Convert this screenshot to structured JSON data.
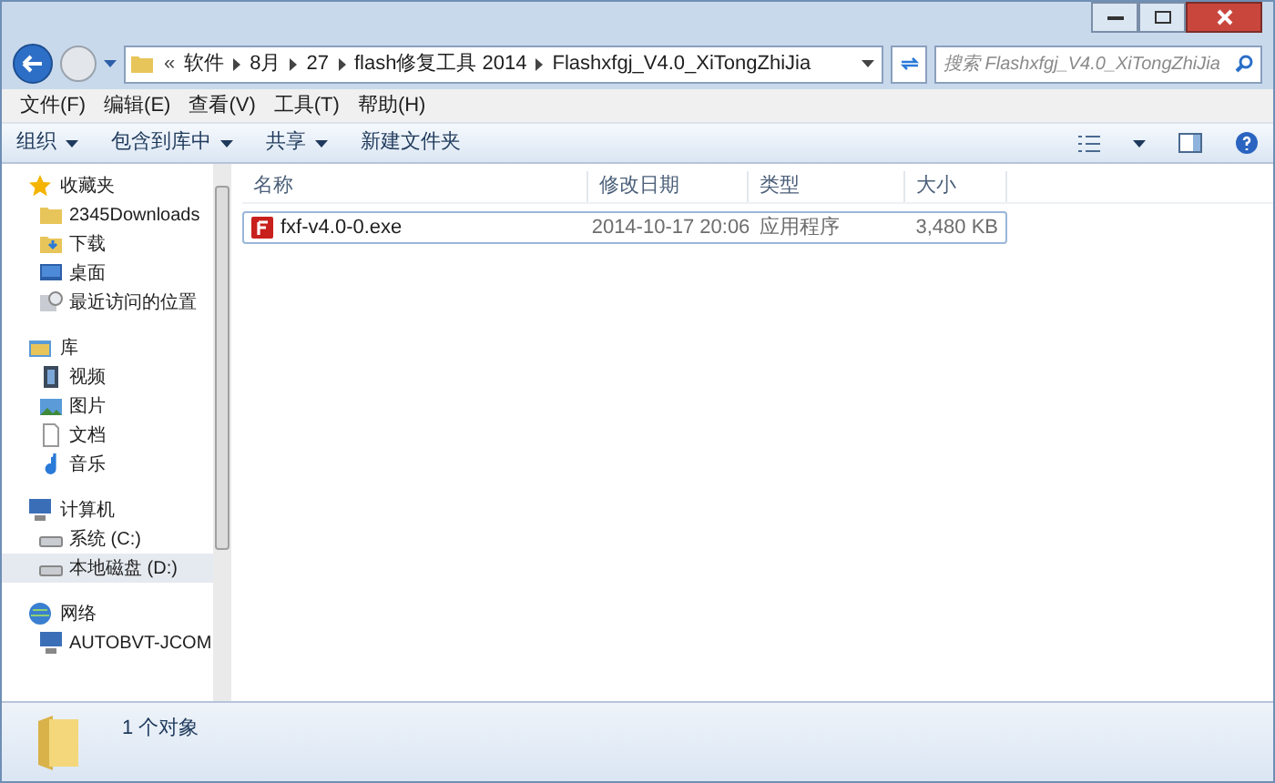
{
  "address": {
    "overflow": "«",
    "crumbs": [
      "软件",
      "8月",
      "27",
      "flash修复工具 2014",
      "Flashxfgj_V4.0_XiTongZhiJia"
    ]
  },
  "search": {
    "placeholder": "搜索 Flashxfgj_V4.0_XiTongZhiJia"
  },
  "menu": [
    "文件(F)",
    "编辑(E)",
    "查看(V)",
    "工具(T)",
    "帮助(H)"
  ],
  "toolbar": [
    {
      "label": "组织",
      "dropdown": true
    },
    {
      "label": "包含到库中",
      "dropdown": true
    },
    {
      "label": "共享",
      "dropdown": true
    },
    {
      "label": "新建文件夹",
      "dropdown": false
    }
  ],
  "sidebar": [
    {
      "label": "收藏夹",
      "kind": "favorites",
      "children": [
        {
          "label": "2345Downloads",
          "kind": "folder",
          "selected": false
        },
        {
          "label": "下载",
          "kind": "downloads",
          "selected": false
        },
        {
          "label": "桌面",
          "kind": "desktop",
          "selected": false
        },
        {
          "label": "最近访问的位置",
          "kind": "recent",
          "selected": false
        }
      ]
    },
    {
      "label": "库",
      "kind": "library",
      "children": [
        {
          "label": "视频",
          "kind": "video",
          "selected": false
        },
        {
          "label": "图片",
          "kind": "picture",
          "selected": false
        },
        {
          "label": "文档",
          "kind": "document",
          "selected": false
        },
        {
          "label": "音乐",
          "kind": "music",
          "selected": false
        }
      ]
    },
    {
      "label": "计算机",
      "kind": "computer",
      "children": [
        {
          "label": "系统 (C:)",
          "kind": "drive",
          "selected": false
        },
        {
          "label": "本地磁盘 (D:)",
          "kind": "drive",
          "selected": true
        }
      ]
    },
    {
      "label": "网络",
      "kind": "network",
      "children": [
        {
          "label": "AUTOBVT-JCOM",
          "kind": "computer",
          "selected": false
        }
      ]
    }
  ],
  "columns": [
    "名称",
    "修改日期",
    "类型",
    "大小"
  ],
  "rows": [
    {
      "name": "fxf-v4.0-0.exe",
      "date": "2014-10-17 20:06",
      "type": "应用程序",
      "size": "3,480 KB",
      "selected": true
    }
  ],
  "status": "1 个对象"
}
